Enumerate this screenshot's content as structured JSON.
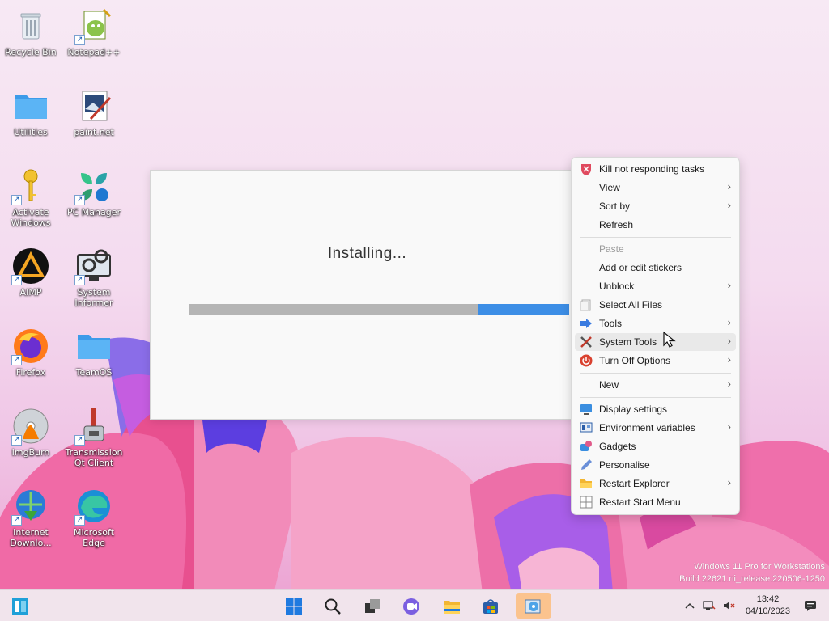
{
  "desktop": {
    "icons": [
      {
        "label": "Recycle Bin",
        "icon": "recycle-bin-icon"
      },
      {
        "label": "Notepad++",
        "icon": "notepad-plus-icon"
      },
      {
        "label": "Utilities",
        "icon": "folder-icon"
      },
      {
        "label": "paint.net",
        "icon": "paintnet-icon"
      },
      {
        "label": "Activate Windows",
        "icon": "key-icon"
      },
      {
        "label": "PC Manager",
        "icon": "pc-manager-icon"
      },
      {
        "label": "AIMP",
        "icon": "aimp-icon"
      },
      {
        "label": "System Informer",
        "icon": "system-informer-icon"
      },
      {
        "label": "Firefox",
        "icon": "firefox-icon"
      },
      {
        "label": "TeamOS",
        "icon": "folder-icon"
      },
      {
        "label": "ImgBurn",
        "icon": "imgburn-icon"
      },
      {
        "label": "Transmission Qt Client",
        "icon": "transmission-icon"
      },
      {
        "label": "Internet Downlo...",
        "icon": "idm-icon"
      },
      {
        "label": "Microsoft Edge",
        "icon": "edge-icon"
      }
    ]
  },
  "installer": {
    "status": "Installing...",
    "progress": 0.24
  },
  "context_menu": {
    "items": [
      {
        "label": "Kill not responding tasks",
        "icon": "shield-kill-icon"
      },
      {
        "label": "View",
        "submenu": true
      },
      {
        "label": "Sort by",
        "submenu": true
      },
      {
        "label": "Refresh"
      },
      {
        "label": "Paste",
        "disabled": true
      },
      {
        "label": "Add or edit stickers"
      },
      {
        "label": "Unblock",
        "submenu": true
      },
      {
        "label": "Select All Files",
        "icon": "select-files-icon"
      },
      {
        "label": "Tools",
        "icon": "tools-arrow-icon",
        "submenu": true
      },
      {
        "label": "System Tools",
        "icon": "system-tools-icon",
        "submenu": true,
        "hovered": true
      },
      {
        "label": "Turn Off Options",
        "icon": "power-icon",
        "submenu": true
      },
      {
        "label": "New",
        "submenu": true
      },
      {
        "label": "Display settings",
        "icon": "display-settings-icon"
      },
      {
        "label": "Environment variables",
        "icon": "environment-variables-icon",
        "submenu": true
      },
      {
        "label": "Gadgets",
        "icon": "gadgets-icon"
      },
      {
        "label": "Personalise",
        "icon": "pencil-icon"
      },
      {
        "label": "Restart Explorer",
        "icon": "folder-explorer-icon",
        "submenu": true
      },
      {
        "label": "Restart Start Menu",
        "icon": "start-menu-icon"
      }
    ],
    "arrow": "›"
  },
  "watermark": {
    "line1": "Windows 11 Pro for Workstations",
    "line2": "Build 22621.ni_release.220506-1250"
  },
  "taskbar": {
    "apps": [
      "widgets-icon",
      "start-icon",
      "search-icon",
      "task-view-icon",
      "teams-icon",
      "file-explorer-icon",
      "store-icon",
      "installer-icon"
    ],
    "active_app": "installer-icon",
    "time": "13:42",
    "date": "04/10/2023"
  },
  "colors": {
    "progress_fill": "#3d8ee6",
    "progress_track": "#b5b5b5",
    "taskbar_active": "#fbc38e"
  }
}
